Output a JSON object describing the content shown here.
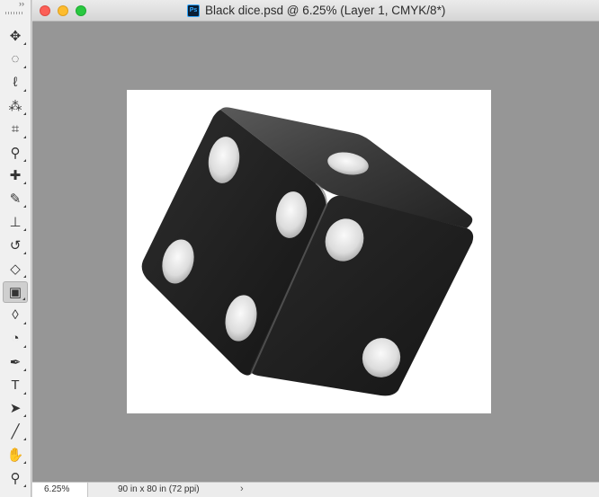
{
  "window": {
    "title": "Black dice.psd @ 6.25% (Layer 1, CMYK/8*)",
    "app_icon": "Ps"
  },
  "tools_panel": {
    "collapse_glyph": "››",
    "tools": [
      {
        "name": "move-tool",
        "glyph": "✥"
      },
      {
        "name": "marquee-tool",
        "glyph": "◌"
      },
      {
        "name": "lasso-tool",
        "glyph": "ℓ"
      },
      {
        "name": "magic-wand-tool",
        "glyph": "⁂"
      },
      {
        "name": "crop-tool",
        "glyph": "⌗"
      },
      {
        "name": "eyedropper-tool",
        "glyph": "⚲"
      },
      {
        "name": "healing-brush-tool",
        "glyph": "✚"
      },
      {
        "name": "brush-tool",
        "glyph": "✎"
      },
      {
        "name": "clone-stamp-tool",
        "glyph": "⊥"
      },
      {
        "name": "history-brush-tool",
        "glyph": "↺"
      },
      {
        "name": "eraser-tool",
        "glyph": "◇"
      },
      {
        "name": "gradient-tool",
        "glyph": "▣",
        "selected": true
      },
      {
        "name": "blur-tool",
        "glyph": "◊"
      },
      {
        "name": "dodge-tool",
        "glyph": "◔"
      },
      {
        "name": "pen-tool",
        "glyph": "✒"
      },
      {
        "name": "type-tool",
        "glyph": "T"
      },
      {
        "name": "path-selection-tool",
        "glyph": "➤"
      },
      {
        "name": "line-tool",
        "glyph": "╱"
      },
      {
        "name": "hand-tool",
        "glyph": "✋"
      },
      {
        "name": "zoom-tool",
        "glyph": "⚲"
      }
    ]
  },
  "status_bar": {
    "zoom": "6.25%",
    "doc_info": "90 in x 80 in (72 ppi)",
    "arrow": "›"
  },
  "colors": {
    "canvas_background": "#969696",
    "artboard": "#ffffff",
    "dice_body": "#1a1a1a",
    "pip": "#e8e8e8"
  }
}
